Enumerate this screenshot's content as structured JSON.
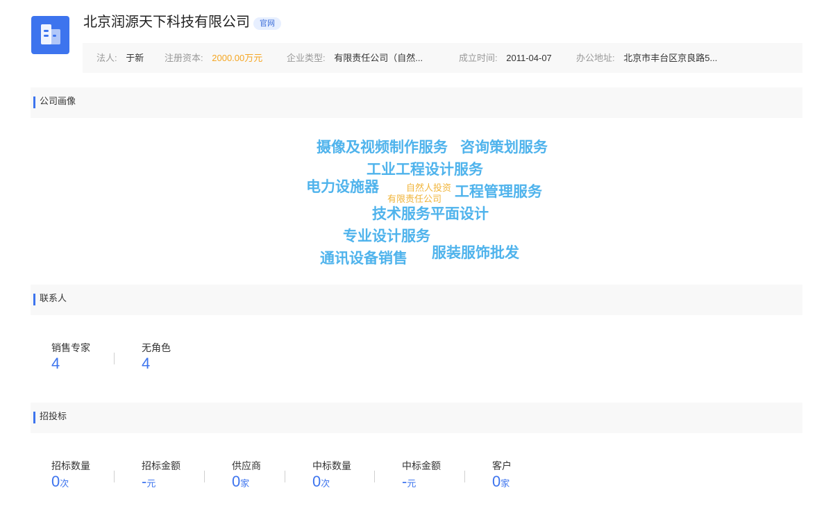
{
  "company": {
    "name": "北京润源天下科技有限公司",
    "official_tag": "官网"
  },
  "info": {
    "legal_rep_label": "法人:",
    "legal_rep": "于新",
    "capital_label": "注册资本:",
    "capital": "2000.00万元",
    "type_label": "企业类型:",
    "type": "有限责任公司（自然...",
    "founded_label": "成立时间:",
    "founded": "2011-04-07",
    "address_label": "办公地址:",
    "address": "北京市丰台区京良路5..."
  },
  "portrait": {
    "title": "公司画像",
    "words": [
      "摄像及视频制作服务",
      "咨询策划服务",
      "工业工程设计服务",
      "电力设施器",
      "自然人投资",
      "有限责任公司",
      "工程管理服务",
      "技术服务平面设计",
      "专业设计服务",
      "通讯设备销售",
      "服装服饰批发"
    ]
  },
  "contacts": {
    "title": "联系人",
    "stats": [
      {
        "label": "销售专家",
        "value": "4"
      },
      {
        "label": "无角色",
        "value": "4"
      }
    ]
  },
  "bidding": {
    "title": "招投标",
    "stats": [
      {
        "label": "招标数量",
        "value": "0",
        "unit": "次"
      },
      {
        "label": "招标金额",
        "value": "-",
        "unit": "元"
      },
      {
        "label": "供应商",
        "value": "0",
        "unit": "家"
      },
      {
        "label": "中标数量",
        "value": "0",
        "unit": "次"
      },
      {
        "label": "中标金额",
        "value": "-",
        "unit": "元"
      },
      {
        "label": "客户",
        "value": "0",
        "unit": "家"
      }
    ]
  },
  "colors": {
    "accent": "#3d74ee",
    "capital": "#f5a623",
    "cloud_primary": "#4fb3ec",
    "cloud_secondary": "#f0b43a"
  },
  "icons": {
    "logo": "building-icon"
  }
}
